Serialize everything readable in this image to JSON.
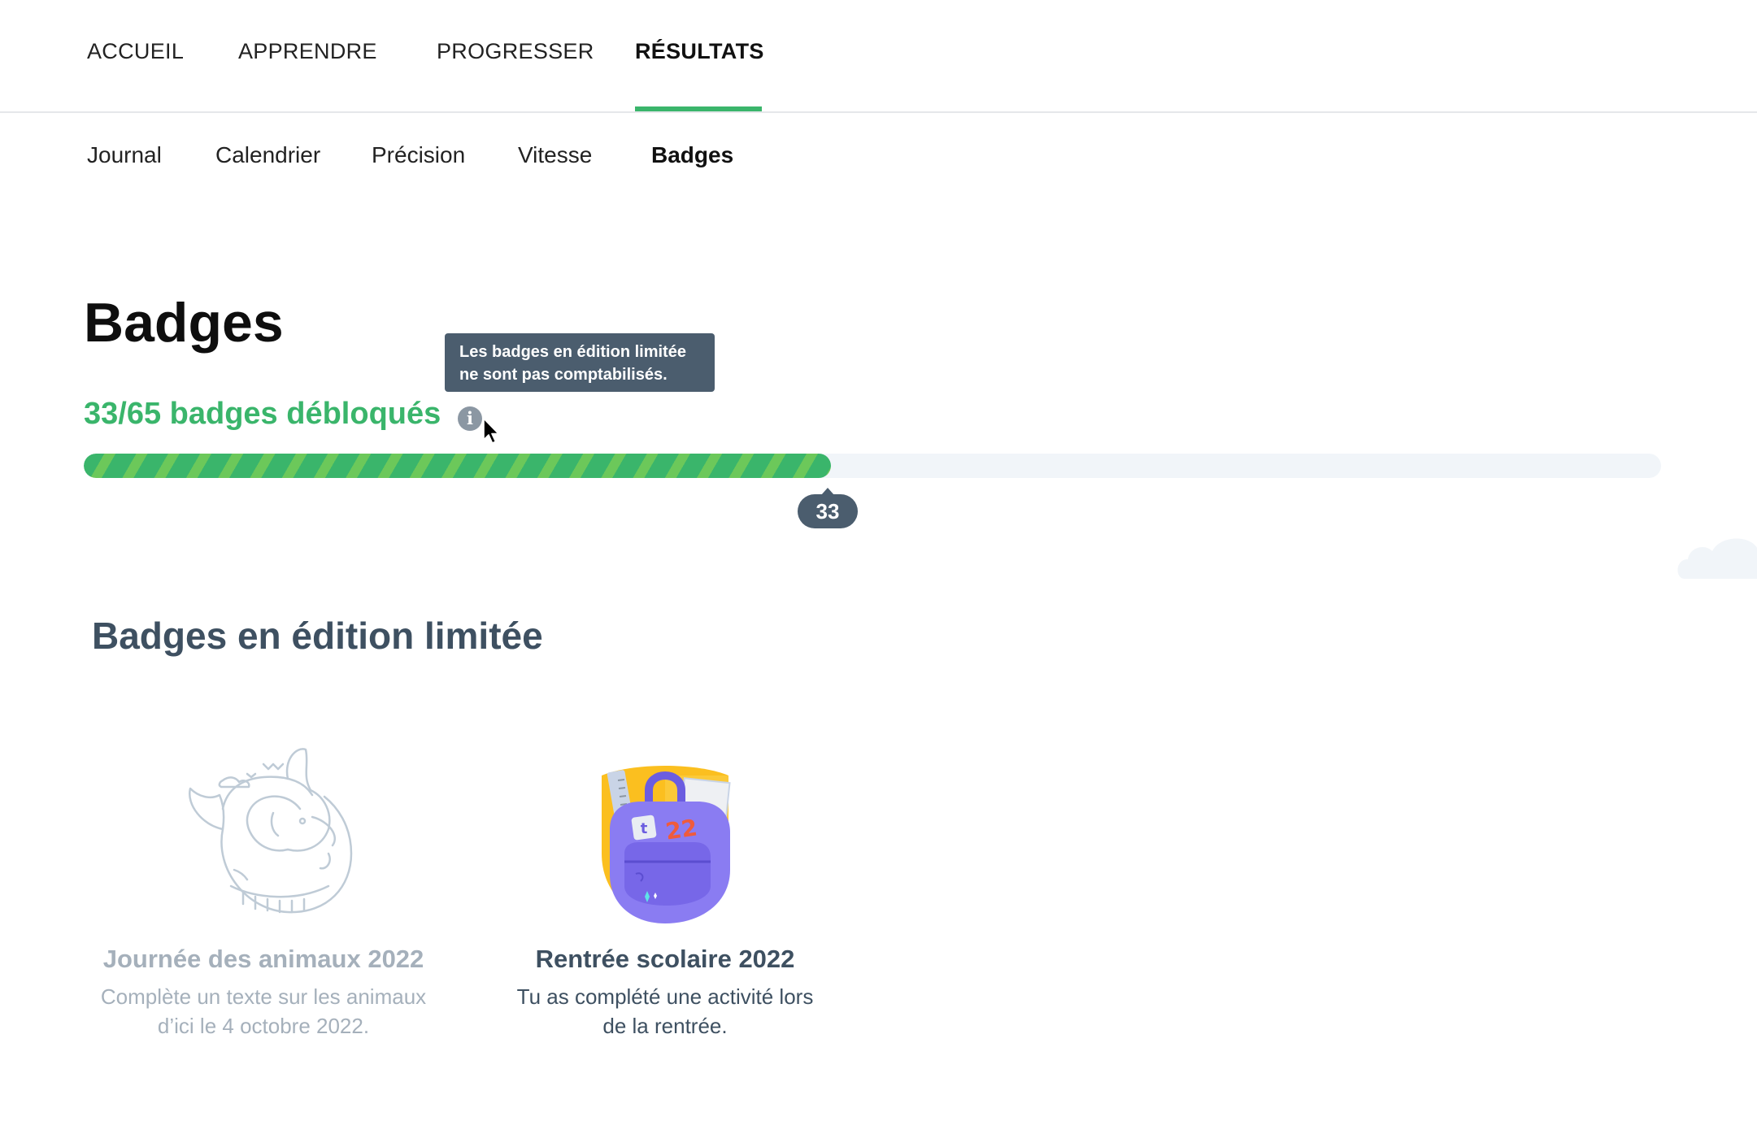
{
  "top_nav": [
    {
      "label": "ACCUEIL",
      "active": false
    },
    {
      "label": "APPRENDRE",
      "active": false
    },
    {
      "label": "PROGRESSER",
      "active": false
    },
    {
      "label": "RÉSULTATS",
      "active": true
    }
  ],
  "sub_nav": [
    {
      "label": "Journal",
      "active": false
    },
    {
      "label": "Calendrier",
      "active": false
    },
    {
      "label": "Précision",
      "active": false
    },
    {
      "label": "Vitesse",
      "active": false
    },
    {
      "label": "Badges",
      "active": true
    }
  ],
  "page_title": "Badges",
  "progress": {
    "label": "33/65 badges débloqués",
    "unlocked": 33,
    "total": 65,
    "marker_label": "33",
    "fraction": 0.4738
  },
  "tooltip": {
    "line1": "Les badges en édition limitée",
    "line2": "ne sont pas comptabilisés."
  },
  "limited_section": {
    "title": "Badges en édition limitée",
    "badges": [
      {
        "title": "Journée des animaux 2022",
        "desc_line1": "Complète un texte sur les animaux",
        "desc_line2": "d’ici le 4 octobre 2022.",
        "state": "locked"
      },
      {
        "title": "Rentrée scolaire 2022",
        "desc_line1": "Tu as complété une activité lors",
        "desc_line2": "de la rentrée.",
        "state": "unlocked"
      }
    ]
  },
  "colors": {
    "accent": "#3ab56b",
    "dark_slate": "#4b5d6e",
    "heading_slate": "#3e5061",
    "muted": "#a5b0bb"
  }
}
